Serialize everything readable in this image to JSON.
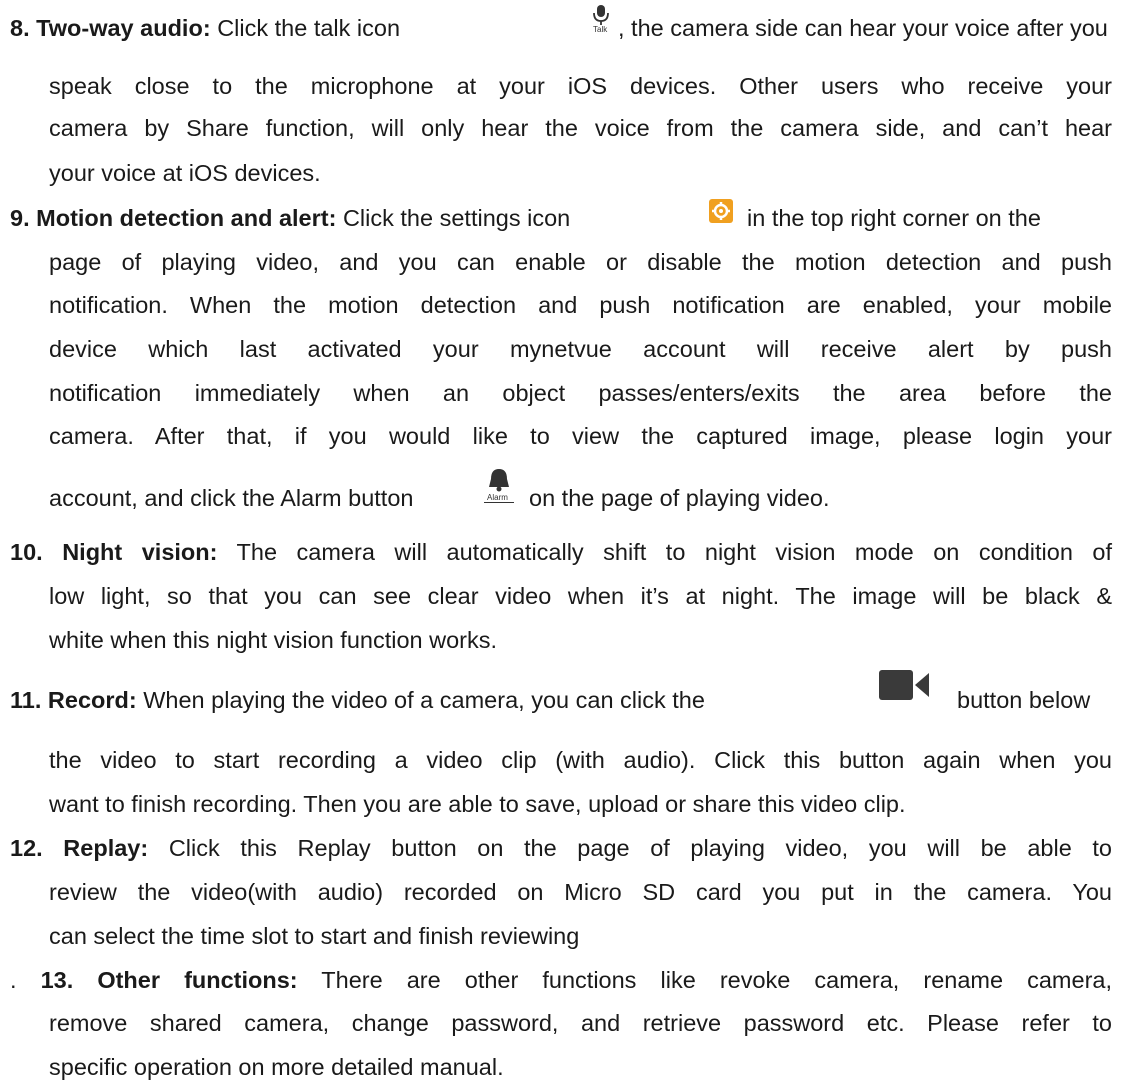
{
  "s8": {
    "num": "8.",
    "title": "Two-way audio:",
    "l1a": "Click the talk icon",
    "talk_label": "Talk",
    "l1b": ", the camera side can hear your voice after you",
    "l2": "speak close to the microphone at your iOS devices. Other users who receive your",
    "l3": "camera by Share function, will only hear the voice from the camera side, and can’t hear",
    "l4": "your voice at iOS devices."
  },
  "s9": {
    "num": "9.",
    "title": "Motion detection and alert:",
    "l1a": "Click the settings icon",
    "l1b": "in the top right corner on the",
    "l2": "page of playing video, and you can enable or disable the motion detection and push",
    "l3": "notification. When the motion detection and push notification are enabled, your mobile",
    "l4": "device which last activated your mynetvue account will receive alert by push",
    "l5": "notification immediately when an object passes/enters/exits the area before the",
    "l6": "camera. After that, if you would like to view the captured image, please login your",
    "l7a": "account, and click the Alarm button",
    "alarm_label": "Alarm",
    "l7b": "on the page of playing video."
  },
  "s10": {
    "num": "10.",
    "title": "Night vision:",
    "l1": "The camera will automatically shift to night vision mode on condition of",
    "l2": "low light, so that you can see clear video when it’s at night. The image will be black &",
    "l3": "white when this night vision function works."
  },
  "s11": {
    "num": "11.",
    "title": "Record:",
    "l1a": "When playing the video of a camera, you can click the",
    "l1b": "button below",
    "l2": "the video to start recording a video clip (with audio). Click this button again when you",
    "l3": "want to finish recording. Then you are able to save, upload or share this video clip."
  },
  "s12": {
    "num": "12.",
    "title": "Replay:",
    "l1": "Click this Replay button on the page of playing video, you will be able to",
    "l2": "review the video(with audio) recorded on Micro SD card you put in the camera. You",
    "l3": "can select the time slot to start and finish reviewing"
  },
  "s13": {
    "lead": ".",
    "num": "13.",
    "title": "Other functions:",
    "l1": "There are other functions like revoke camera, rename camera,",
    "l2": "remove shared camera, change password, and retrieve password etc. Please refer to",
    "l3": "specific operation on more detailed manual."
  },
  "colors": {
    "text": "#1a1a1a",
    "settings_orange": "#f0a020",
    "icon_dark": "#3a3a3a"
  }
}
